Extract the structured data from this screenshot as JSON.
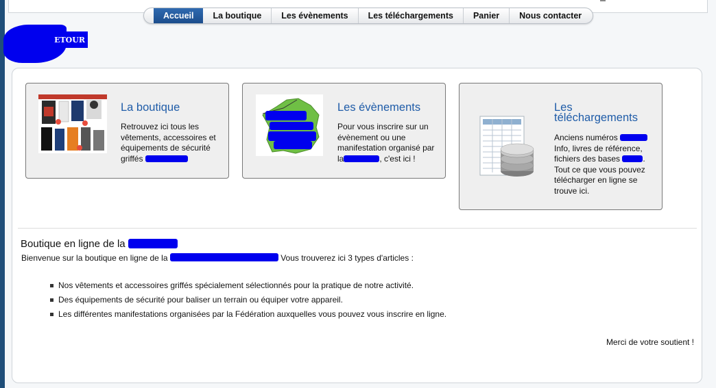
{
  "nav": {
    "items": [
      {
        "label": "Accueil",
        "active": true
      },
      {
        "label": "La boutique",
        "active": false
      },
      {
        "label": "Les évènements",
        "active": false
      },
      {
        "label": "Les téléchargements",
        "active": false
      },
      {
        "label": "Panier",
        "active": false
      },
      {
        "label": "Nous contacter",
        "active": false
      }
    ]
  },
  "logo": {
    "text": "ETOUR"
  },
  "cards": {
    "boutique": {
      "title": "La boutique",
      "text_1": "Retrouvez ici tous les",
      "text_2": "vêtements, accessoires et",
      "text_3": "équipements de sécurité",
      "text_4": "griffés"
    },
    "evenements": {
      "title": "Les évènements",
      "text_1": "Pour vous inscrire sur un",
      "text_2": "évènement ou une",
      "text_3": "manifestation organisé par",
      "text_4_prefix": "la",
      "text_4_suffix": ", c'est ici !"
    },
    "telechargements": {
      "title_1": "Les",
      "title_2": "téléchargements",
      "text_1": "Anciens numéros",
      "text_2": "Info, livres de référence,",
      "text_3": "fichiers des bases",
      "text_4": "Tout ce que vous pouvez",
      "text_5": "télécharger en ligne se",
      "text_6": "trouve ici."
    }
  },
  "section": {
    "title": "Boutique en ligne de la",
    "intro_prefix": "Bienvenue sur la boutique en ligne de la",
    "intro_suffix": "Vous trouverez ici 3 types d'articles :",
    "bullets": [
      "Nos vêtements et accessoires griffés spécialement sélectionnés pour la pratique de notre activité.",
      "Des équipements de sécurité pour baliser un terrain ou équiper votre appareil.",
      "Les différentes manifestations organisées par la Fédération auxquelles vous pouvez vous inscrire en ligne."
    ],
    "thanks": "Merci de votre soutient !"
  },
  "colors": {
    "accent": "#1f5ca8",
    "redaction": "#0000ee",
    "nav_active": "#1c4d8c"
  }
}
